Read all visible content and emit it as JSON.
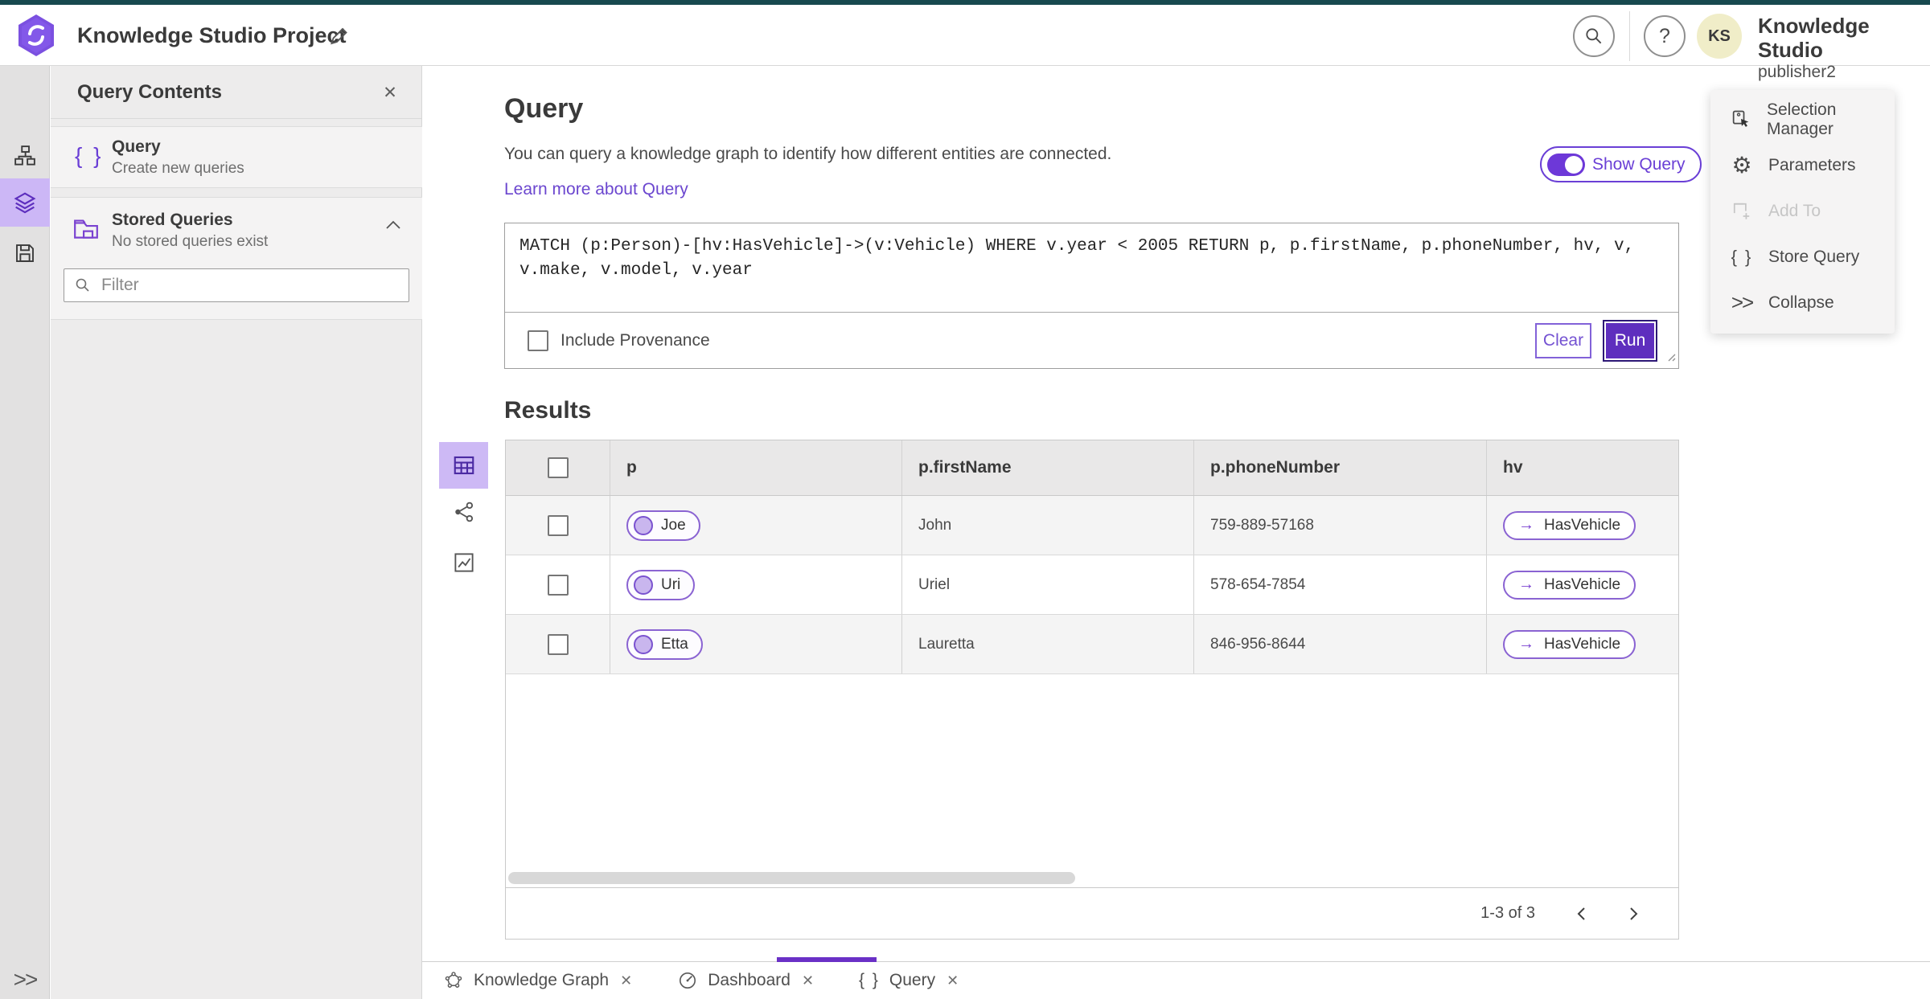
{
  "topbar": {
    "title": "Knowledge Studio Project",
    "product": "Knowledge Studio",
    "user": "publisher2",
    "initials": "KS"
  },
  "glyphs": {
    "close": "✕",
    "help": "?",
    "collapse": ">>",
    "braces": "{ }",
    "edge_arrow": "→"
  },
  "sidebar": {
    "header": "Query Contents",
    "query_item": {
      "label": "Query",
      "sublabel": "Create new queries"
    },
    "stored": {
      "label": "Stored Queries",
      "sublabel": "No stored queries exist"
    },
    "filter_placeholder": "Filter"
  },
  "query": {
    "title": "Query",
    "description": "You can query a knowledge graph to identify how different entities are connected.",
    "link": "Learn more about Query",
    "toggle_label": "Show Query",
    "code": "MATCH (p:Person)-[hv:HasVehicle]->(v:Vehicle) WHERE v.year < 2005 RETURN p, p.firstName, p.phoneNumber, hv, v, v.make, v.model, v.year",
    "include_label": "Include Provenance",
    "clear_label": "Clear",
    "run_label": "Run"
  },
  "results": {
    "title": "Results",
    "columns": [
      "p",
      "p.firstName",
      "p.phoneNumber",
      "hv"
    ],
    "rows": [
      {
        "node": "Joe",
        "first_name": "John",
        "phone": "759-889-57168",
        "edge": "HasVehicle"
      },
      {
        "node": "Uri",
        "first_name": "Uriel",
        "phone": "578-654-7854",
        "edge": "HasVehicle"
      },
      {
        "node": "Etta",
        "first_name": "Lauretta",
        "phone": "846-956-8644",
        "edge": "HasVehicle"
      }
    ],
    "pagination": "1-3 of 3"
  },
  "menu": {
    "items": [
      {
        "label": "Selection Manager",
        "disabled": false
      },
      {
        "label": "Parameters",
        "disabled": false
      },
      {
        "label": "Add To",
        "disabled": true
      },
      {
        "label": "Store Query",
        "disabled": false
      },
      {
        "label": "Collapse",
        "disabled": false
      }
    ]
  },
  "tabs": {
    "items": [
      {
        "label": "Knowledge Graph"
      },
      {
        "label": "Dashboard"
      },
      {
        "label": "Query",
        "active": true
      }
    ]
  },
  "colors": {
    "accent_purple": "#5e2ebe",
    "accent_purple_light": "#8a63d2",
    "selection_bg": "#ccb7f6",
    "top_strip_teal": "#17494f",
    "link_purple": "#6b46cf",
    "avatar_bg": "#f0edc8"
  }
}
